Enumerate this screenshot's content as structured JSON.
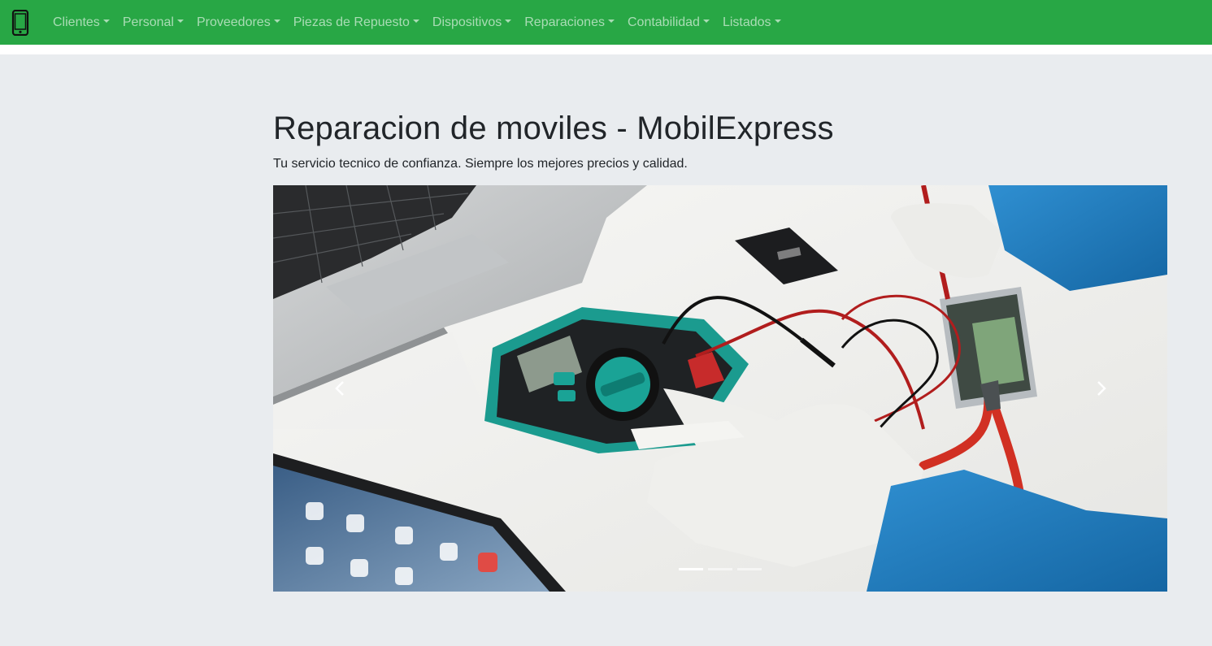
{
  "navbar": {
    "brand_icon": "mobile-phone-icon",
    "menu": [
      {
        "label": "Clientes"
      },
      {
        "label": "Personal"
      },
      {
        "label": "Proveedores"
      },
      {
        "label": "Piezas de Repuesto"
      },
      {
        "label": "Dispositivos"
      },
      {
        "label": "Reparaciones"
      },
      {
        "label": "Contabilidad"
      },
      {
        "label": "Listados"
      }
    ]
  },
  "jumbotron": {
    "title": "Reparacion de moviles - MobilExpress",
    "subtitle": "Tu servicio tecnico de confianza. Siempre los mejores precios y calidad."
  },
  "carousel": {
    "slide_count": 3,
    "active_slide": 1,
    "prev_icon": "chevron-left-icon",
    "next_icon": "chevron-right-icon"
  },
  "colors": {
    "navbar": "#28a745",
    "background": "#e9ecef",
    "nav_link": "rgba(255,255,255,0.6)"
  }
}
